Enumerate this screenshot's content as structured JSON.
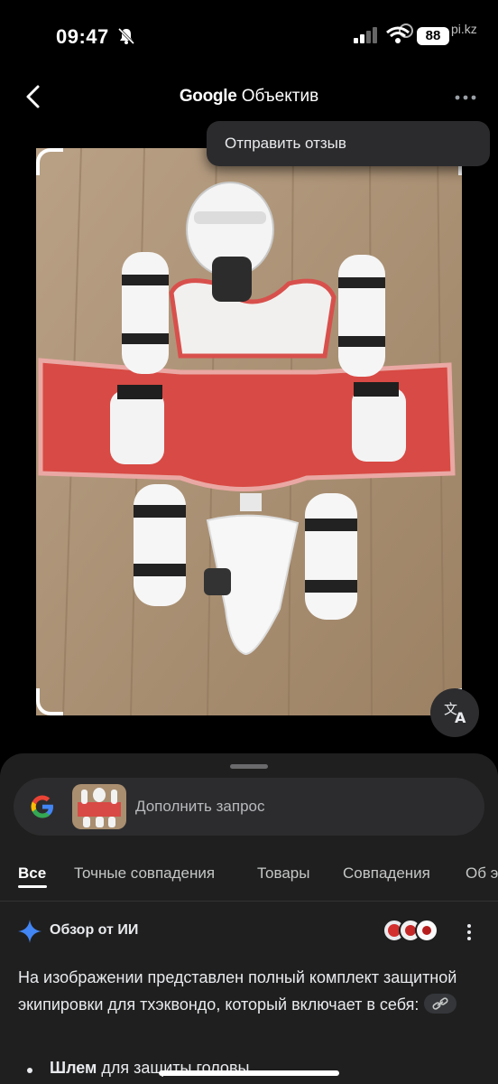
{
  "status_bar": {
    "time": "09:47",
    "battery": "88",
    "watermark": "pi.kz"
  },
  "app_bar": {
    "title_brand": "Google",
    "title_product": "Объектив"
  },
  "menu": {
    "send_feedback": "Отправить отзыв"
  },
  "search": {
    "placeholder": "Дополнить запрос"
  },
  "tabs": [
    {
      "label": "Все",
      "active": true
    },
    {
      "label": "Точные совпадения"
    },
    {
      "label": "Товары"
    },
    {
      "label": "Совпадения"
    },
    {
      "label": "Об э"
    }
  ],
  "ai_overview": {
    "title": "Обзор от ИИ",
    "text": "На изображении представлен полный комплект защитной экипировки для тхэквондо, который включает в себя:",
    "bullet_bold": "Шлем",
    "bullet_rest": " для защиты головы"
  },
  "colors": {
    "accent_blue": "#4285f4",
    "sheet_bg": "#1f1f1f",
    "vest_red": "#d84a45"
  },
  "icons": [
    "back-arrow-icon",
    "more-horiz-icon",
    "translate-icon",
    "google-g-icon",
    "sparkle-icon",
    "link-icon",
    "kebab-icon"
  ]
}
